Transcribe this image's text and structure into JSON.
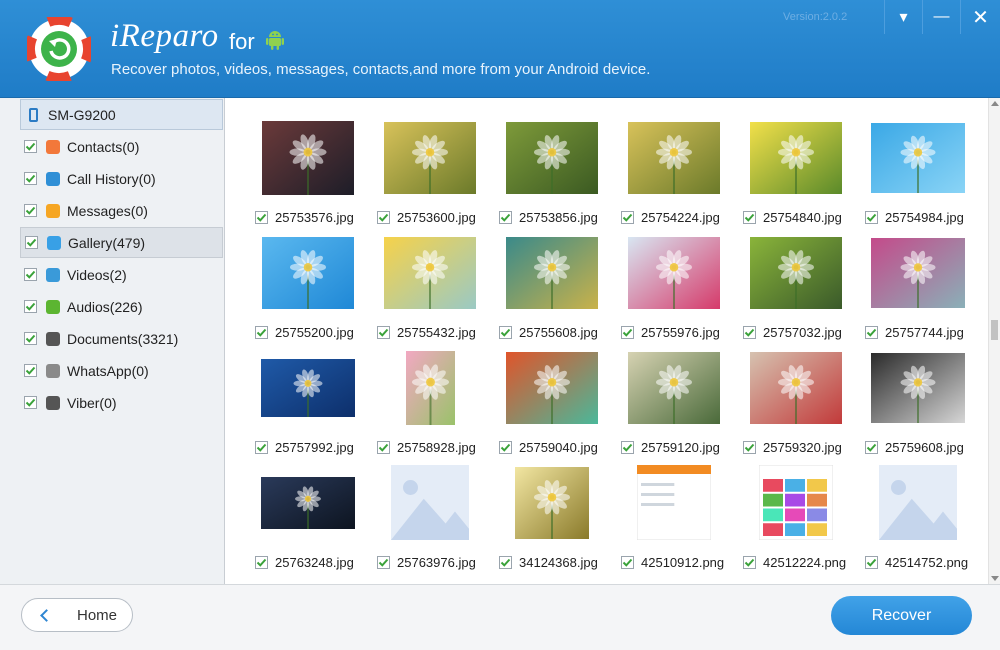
{
  "app": {
    "brand": "iReparo",
    "brand_for": "for",
    "tagline": "Recover photos, videos, messages, contacts,and more from your Android device.",
    "version": "Version:2.0.2",
    "window_controls": {
      "menu": "▾",
      "minimize": "—",
      "close": "✕"
    }
  },
  "sidebar": {
    "device": "SM-G9200",
    "items": [
      {
        "label": "Contacts(0)",
        "icon": "contacts-icon",
        "color": "#f2783a"
      },
      {
        "label": "Call History(0)",
        "icon": "call-history-icon",
        "color": "#2f8fd6"
      },
      {
        "label": "Messages(0)",
        "icon": "messages-icon",
        "color": "#f6a623"
      },
      {
        "label": "Gallery(479)",
        "icon": "gallery-icon",
        "color": "#38a0e6"
      },
      {
        "label": "Videos(2)",
        "icon": "videos-icon",
        "color": "#3a9ad9"
      },
      {
        "label": "Audios(226)",
        "icon": "audios-icon",
        "color": "#5cb531"
      },
      {
        "label": "Documents(3321)",
        "icon": "documents-icon",
        "color": "#555555"
      },
      {
        "label": "WhatsApp(0)",
        "icon": "whatsapp-icon",
        "color": "#8a8a8a"
      },
      {
        "label": "Viber(0)",
        "icon": "viber-icon",
        "color": "#555555"
      }
    ],
    "selected_index": 3
  },
  "gallery": {
    "items": [
      {
        "name": "25753576.jpg",
        "type": "photo",
        "c1": "#6b3a3a",
        "c2": "#1d1d28"
      },
      {
        "name": "25753600.jpg",
        "type": "photo",
        "c1": "#d8c25a",
        "c2": "#6b7a2a"
      },
      {
        "name": "25753856.jpg",
        "type": "photo",
        "c1": "#7e9a3a",
        "c2": "#3b5a22"
      },
      {
        "name": "25754224.jpg",
        "type": "photo",
        "c1": "#d8c25a",
        "c2": "#6b7a2a"
      },
      {
        "name": "25754840.jpg",
        "type": "photo",
        "c1": "#f2e04a",
        "c2": "#5a8a2a"
      },
      {
        "name": "25754984.jpg",
        "type": "photo",
        "c1": "#3aa8e6",
        "c2": "#8ad4f6"
      },
      {
        "name": "25755200.jpg",
        "type": "photo",
        "c1": "#5ab8ef",
        "c2": "#1f88d6"
      },
      {
        "name": "25755432.jpg",
        "type": "photo",
        "c1": "#f6d24a",
        "c2": "#9ac9c4"
      },
      {
        "name": "25755608.jpg",
        "type": "photo",
        "c1": "#3a8a8a",
        "c2": "#c9b24a"
      },
      {
        "name": "25755976.jpg",
        "type": "photo",
        "c1": "#d8e6f2",
        "c2": "#d63a6a"
      },
      {
        "name": "25757032.jpg",
        "type": "photo",
        "c1": "#8ab43a",
        "c2": "#3a5a2a"
      },
      {
        "name": "25757744.jpg",
        "type": "photo",
        "c1": "#c44a8a",
        "c2": "#8ab0b8"
      },
      {
        "name": "25757992.jpg",
        "type": "photo",
        "c1": "#1f5aa8",
        "c2": "#0d2f6b"
      },
      {
        "name": "25758928.jpg",
        "type": "photo",
        "c1": "#f2a8c2",
        "c2": "#9ac26a"
      },
      {
        "name": "25759040.jpg",
        "type": "photo",
        "c1": "#e0542a",
        "c2": "#4ab89a"
      },
      {
        "name": "25759120.jpg",
        "type": "photo",
        "c1": "#d6d2b2",
        "c2": "#4a6a3a"
      },
      {
        "name": "25759320.jpg",
        "type": "photo",
        "c1": "#d6c2b0",
        "c2": "#c23a3a"
      },
      {
        "name": "25759608.jpg",
        "type": "photo",
        "c1": "#2a2a2a",
        "c2": "#d6d6d6"
      },
      {
        "name": "25763248.jpg",
        "type": "photo",
        "c1": "#2a3a5a",
        "c2": "#0d1420"
      },
      {
        "name": "25763976.jpg",
        "type": "placeholder"
      },
      {
        "name": "34124368.jpg",
        "type": "photo",
        "c1": "#f2e6a2",
        "c2": "#8a7a2a"
      },
      {
        "name": "42510912.png",
        "type": "screenshot"
      },
      {
        "name": "42512224.png",
        "type": "screenshot-grid"
      },
      {
        "name": "42514752.png",
        "type": "placeholder"
      }
    ]
  },
  "footer": {
    "home_label": "Home",
    "recover_label": "Recover"
  },
  "colors": {
    "header": "#2485d0",
    "accent": "#2b87d4",
    "check": "#3aa23a"
  }
}
